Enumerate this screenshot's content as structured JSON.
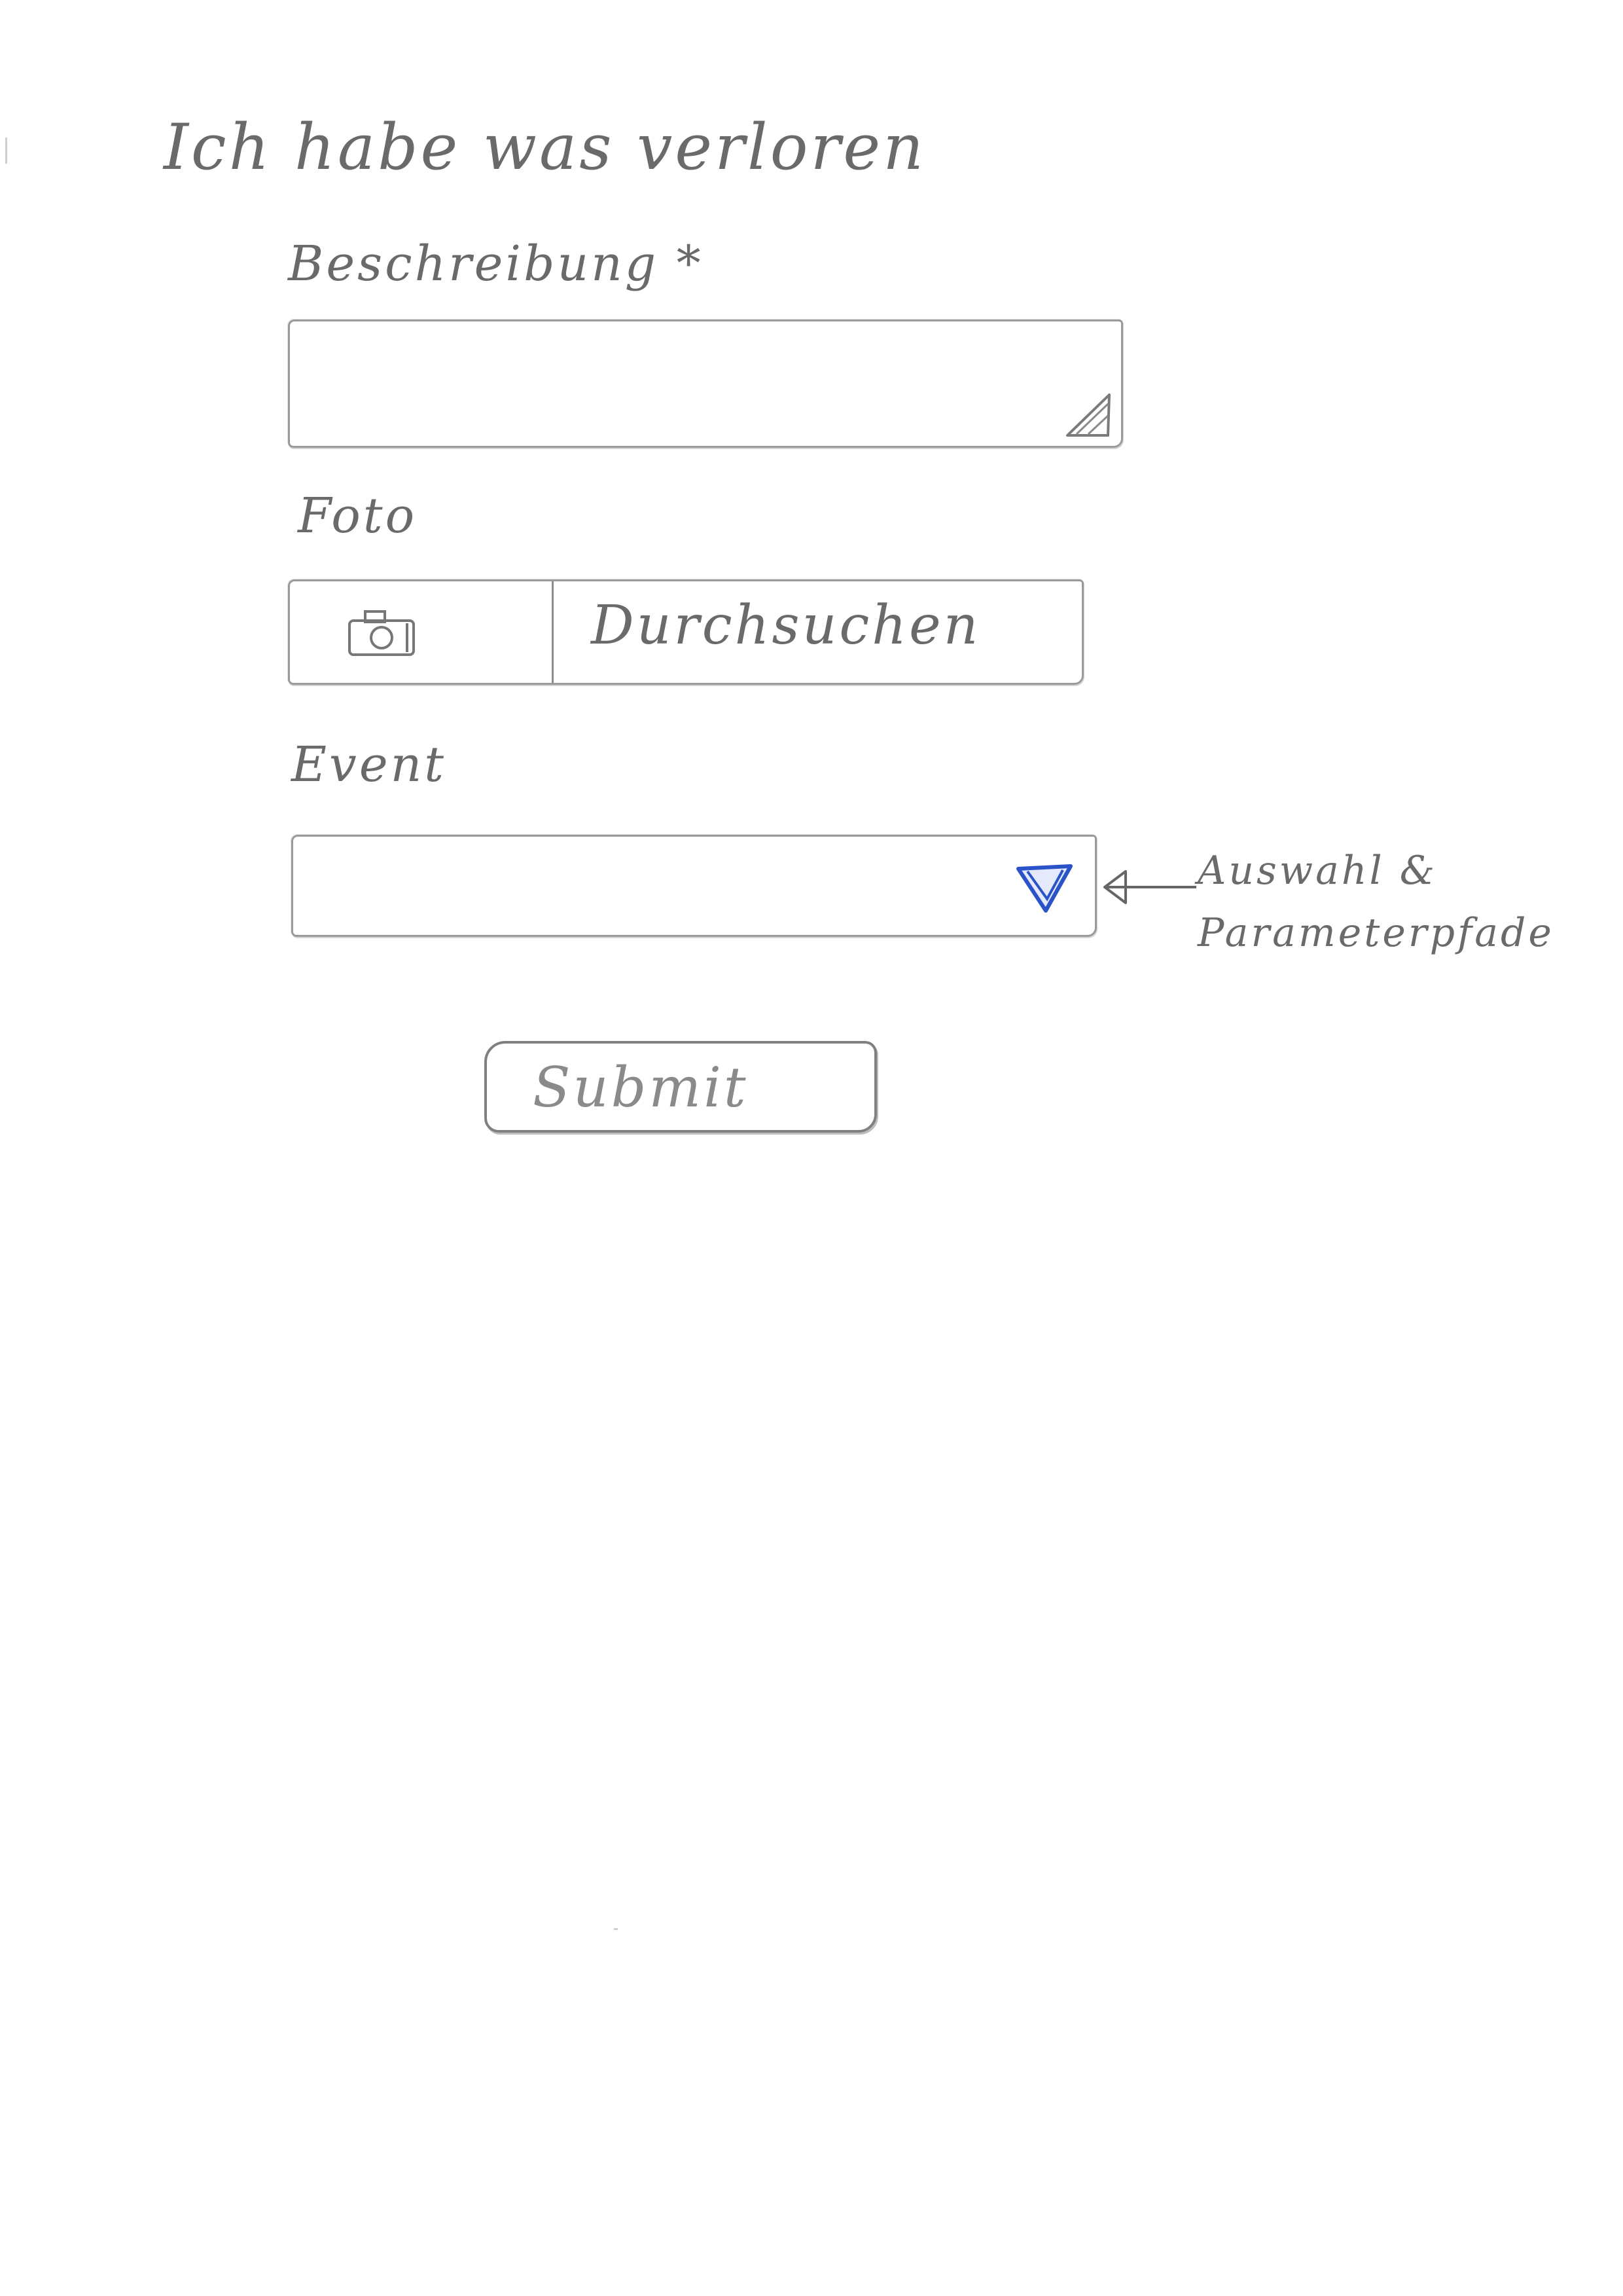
{
  "page": {
    "title": "Ich habe was verloren"
  },
  "form": {
    "description": {
      "label": "Beschreibung *",
      "value": ""
    },
    "photo": {
      "label": "Foto",
      "camera_icon": "camera-icon",
      "browse_label": "Durchsuchen"
    },
    "event": {
      "label": "Event",
      "value": "",
      "dropdown_icon": "triangle-down-icon"
    },
    "submit_label": "Submit"
  },
  "annotation": {
    "arrow_icon": "arrow-left-icon",
    "line1": "Auswahl &",
    "line2": "Parameterpfade"
  },
  "colors": {
    "pencil": "#8a8a8a",
    "pen_blue": "#2a52c9",
    "paper": "#ffffff"
  }
}
